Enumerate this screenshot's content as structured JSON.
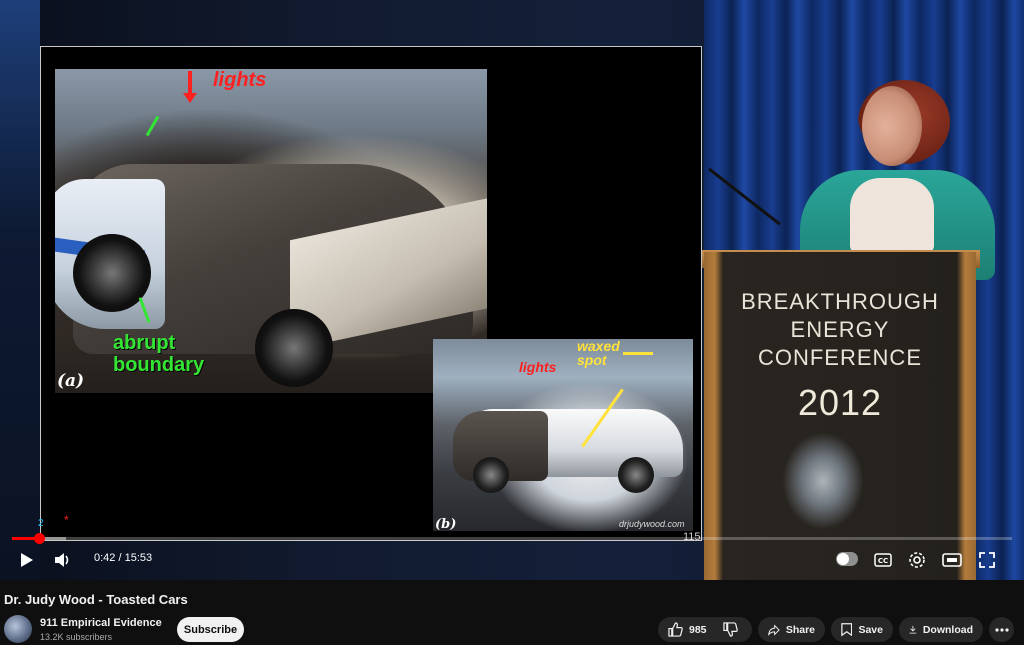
{
  "video": {
    "slide": {
      "labels": {
        "lights": "lights",
        "abrupt_boundary_line1": "abrupt",
        "abrupt_boundary_line2": "boundary",
        "panel_a": "(a)",
        "panel_b": "(b)",
        "lights_b": "lights",
        "waxed_line1": "waxed",
        "waxed_line2": "spot",
        "website": "drjudywood.com",
        "slide_number": "115"
      }
    },
    "podium": {
      "line1": "BREAKTHROUGH",
      "line2": "ENERGY",
      "line3": "CONFERENCE",
      "year": "2012"
    },
    "progress": {
      "played_fraction": 0.027,
      "loaded_fraction": 0.054,
      "chapter_label": "2",
      "marker": "*"
    },
    "controls": {
      "time_current": "0:42",
      "time_separator": " / ",
      "time_total": "15:53",
      "icons": [
        "play-icon",
        "volume-icon",
        "autoplay-toggle",
        "subtitles-icon",
        "settings-icon",
        "theater-icon",
        "fullscreen-icon"
      ]
    }
  },
  "meta": {
    "title": "Dr. Judy Wood - Toasted Cars",
    "channel_name": "911 Empirical Evidence",
    "subscribers": "13.2K subscribers",
    "subscribe_label": "Subscribe",
    "like_count": "985",
    "share_label": "Share",
    "save_label": "Save",
    "download_label": "Download"
  },
  "colors": {
    "accent_red": "#ff0000",
    "annotation_red": "#ff2020",
    "annotation_green": "#33e633",
    "annotation_yellow": "#ffe23a",
    "background": "#0f0f0f",
    "pill": "#272727"
  }
}
